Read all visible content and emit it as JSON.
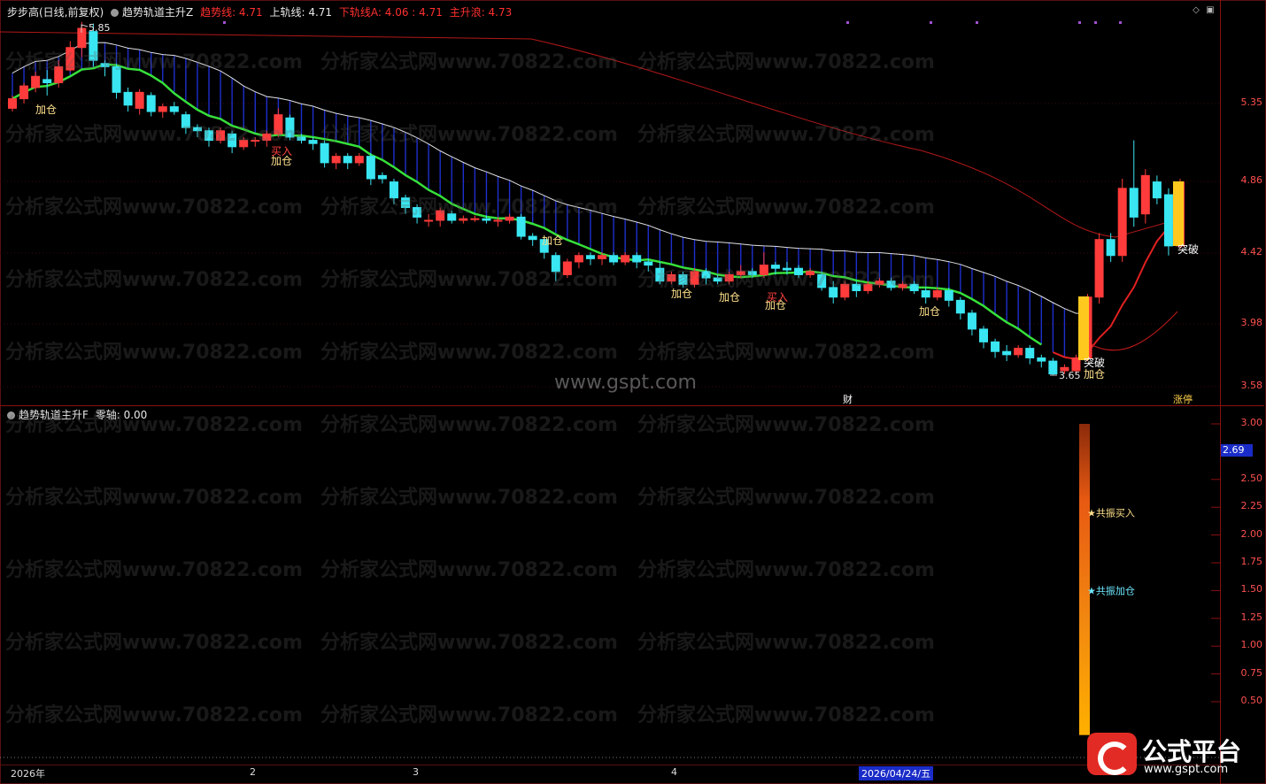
{
  "header": {
    "stock": "步步高(日线,前复权)",
    "indicator": "趋势轨道主升Z",
    "trend_line": "趋势线: 4.71",
    "upper_line": "上轨线: 4.71",
    "lower_line": "下轨线A: 4.06 : 4.71",
    "main_rise": "主升浪: 4.73"
  },
  "sub_header": {
    "indicator": "趋势轨道主升F",
    "zero_axis": "零轴: 0.00"
  },
  "colors": {
    "up": "#ff3b3b",
    "down": "#39e6f2",
    "trend": "#36e03a",
    "upper": "#e0e0e0",
    "fill": "#1e2fcc",
    "red_line": "#e02020",
    "gold": "#ffc81e"
  },
  "price_axis": [
    "5.35",
    "4.86",
    "4.42",
    "3.98",
    "3.58"
  ],
  "sub_axis": [
    "3.00",
    "2.50",
    "2.25",
    "2.00",
    "1.75",
    "1.50",
    "1.25",
    "1.00",
    "0.75",
    "0.50"
  ],
  "sub_value_tag": "2.69",
  "high_label": "5.85",
  "low_label": "3.65",
  "watermark_text": "分析家公式网www.70822.com",
  "center_watermark": "www.gspt.com",
  "dates": {
    "d1": "2026年",
    "d2": "2",
    "d3": "3",
    "d4": "4",
    "d5": "2026/04/24/五"
  },
  "markers": {
    "jiacang": "加仓",
    "mairu": "买入",
    "tupo": "突破",
    "cai": "财",
    "zhangting": "涨停",
    "gongzhen_buy": "★共振买入",
    "gongzhen_add": "★共振加仓"
  },
  "logo": {
    "name": "公式平台",
    "url": "www.gspt.com"
  },
  "chart_data": {
    "type": "candlestick",
    "title": "步步高(日线,前复权)",
    "ylim": [
      3.55,
      5.9
    ],
    "candles": [
      [
        5.32,
        5.38,
        5.3,
        5.4
      ],
      [
        5.38,
        5.46,
        5.35,
        5.48
      ],
      [
        5.45,
        5.52,
        5.42,
        5.55
      ],
      [
        5.5,
        5.48,
        5.4,
        5.56
      ],
      [
        5.48,
        5.58,
        5.45,
        5.62
      ],
      [
        5.56,
        5.7,
        5.55,
        5.74
      ],
      [
        5.7,
        5.82,
        5.64,
        5.86
      ],
      [
        5.8,
        5.62,
        5.58,
        5.85
      ],
      [
        5.6,
        5.58,
        5.52,
        5.62
      ],
      [
        5.58,
        5.42,
        5.38,
        5.6
      ],
      [
        5.42,
        5.34,
        5.3,
        5.45
      ],
      [
        5.32,
        5.42,
        5.28,
        5.44
      ],
      [
        5.4,
        5.3,
        5.27,
        5.42
      ],
      [
        5.3,
        5.33,
        5.26,
        5.35
      ],
      [
        5.33,
        5.3,
        5.28,
        5.36
      ],
      [
        5.28,
        5.2,
        5.16,
        5.3
      ],
      [
        5.2,
        5.18,
        5.14,
        5.22
      ],
      [
        5.18,
        5.12,
        5.08,
        5.2
      ],
      [
        5.12,
        5.18,
        5.1,
        5.2
      ],
      [
        5.16,
        5.08,
        5.04,
        5.18
      ],
      [
        5.08,
        5.12,
        5.06,
        5.14
      ],
      [
        5.12,
        5.12,
        5.08,
        5.14
      ],
      [
        5.12,
        5.16,
        5.08,
        5.18
      ],
      [
        5.16,
        5.28,
        5.14,
        5.32
      ],
      [
        5.26,
        5.14,
        5.12,
        5.28
      ],
      [
        5.14,
        5.12,
        5.1,
        5.16
      ],
      [
        5.12,
        5.1,
        5.06,
        5.14
      ],
      [
        5.1,
        4.98,
        4.95,
        5.12
      ],
      [
        4.98,
        5.02,
        4.94,
        5.04
      ],
      [
        5.02,
        4.98,
        4.94,
        5.04
      ],
      [
        4.98,
        5.02,
        4.96,
        5.04
      ],
      [
        5.02,
        4.88,
        4.84,
        5.04
      ],
      [
        4.9,
        4.88,
        4.85,
        4.92
      ],
      [
        4.86,
        4.76,
        4.72,
        4.88
      ],
      [
        4.76,
        4.7,
        4.66,
        4.78
      ],
      [
        4.7,
        4.64,
        4.6,
        4.72
      ],
      [
        4.62,
        4.62,
        4.58,
        4.66
      ],
      [
        4.62,
        4.68,
        4.58,
        4.7
      ],
      [
        4.66,
        4.62,
        4.6,
        4.68
      ],
      [
        4.62,
        4.63,
        4.6,
        4.65
      ],
      [
        4.63,
        4.63,
        4.61,
        4.65
      ],
      [
        4.63,
        4.62,
        4.6,
        4.65
      ],
      [
        4.62,
        4.62,
        4.58,
        4.64
      ],
      [
        4.62,
        4.64,
        4.6,
        4.66
      ],
      [
        4.64,
        4.52,
        4.5,
        4.66
      ],
      [
        4.52,
        4.5,
        4.46,
        4.54
      ],
      [
        4.5,
        4.42,
        4.38,
        4.52
      ],
      [
        4.4,
        4.3,
        4.24,
        4.42
      ],
      [
        4.28,
        4.36,
        4.26,
        4.38
      ],
      [
        4.36,
        4.4,
        4.32,
        4.42
      ],
      [
        4.4,
        4.38,
        4.34,
        4.42
      ],
      [
        4.38,
        4.4,
        4.34,
        4.42
      ],
      [
        4.4,
        4.36,
        4.34,
        4.42
      ],
      [
        4.36,
        4.4,
        4.34,
        4.42
      ],
      [
        4.4,
        4.36,
        4.32,
        4.42
      ],
      [
        4.36,
        4.34,
        4.3,
        4.38
      ],
      [
        4.32,
        4.24,
        4.22,
        4.36
      ],
      [
        4.24,
        4.28,
        4.22,
        4.3
      ],
      [
        4.28,
        4.22,
        4.2,
        4.3
      ],
      [
        4.22,
        4.3,
        4.2,
        4.32
      ],
      [
        4.3,
        4.26,
        4.22,
        4.32
      ],
      [
        4.26,
        4.24,
        4.22,
        4.28
      ],
      [
        4.24,
        4.28,
        4.22,
        4.3
      ],
      [
        4.28,
        4.3,
        4.26,
        4.34
      ],
      [
        4.3,
        4.28,
        4.26,
        4.32
      ],
      [
        4.28,
        4.34,
        4.26,
        4.42
      ],
      [
        4.34,
        4.32,
        4.28,
        4.36
      ],
      [
        4.32,
        4.31,
        4.28,
        4.36
      ],
      [
        4.32,
        4.28,
        4.26,
        4.34
      ],
      [
        4.28,
        4.3,
        4.26,
        4.32
      ],
      [
        4.28,
        4.2,
        4.18,
        4.3
      ],
      [
        4.2,
        4.14,
        4.1,
        4.24
      ],
      [
        4.14,
        4.22,
        4.12,
        4.24
      ],
      [
        4.22,
        4.18,
        4.14,
        4.24
      ],
      [
        4.18,
        4.22,
        4.16,
        4.24
      ],
      [
        4.22,
        4.24,
        4.2,
        4.26
      ],
      [
        4.24,
        4.2,
        4.18,
        4.26
      ],
      [
        4.2,
        4.22,
        4.18,
        4.24
      ],
      [
        4.22,
        4.18,
        4.16,
        4.24
      ],
      [
        4.18,
        4.14,
        4.1,
        4.2
      ],
      [
        4.14,
        4.18,
        4.12,
        4.2
      ],
      [
        4.18,
        4.12,
        4.08,
        4.2
      ],
      [
        4.12,
        4.04,
        4.0,
        4.14
      ],
      [
        4.04,
        3.94,
        3.9,
        4.06
      ],
      [
        3.94,
        3.86,
        3.82,
        3.96
      ],
      [
        3.86,
        3.8,
        3.76,
        3.88
      ],
      [
        3.8,
        3.78,
        3.74,
        3.84
      ],
      [
        3.78,
        3.82,
        3.76,
        3.84
      ],
      [
        3.82,
        3.76,
        3.72,
        3.84
      ],
      [
        3.76,
        3.74,
        3.7,
        3.78
      ],
      [
        3.74,
        3.66,
        3.65,
        3.76
      ],
      [
        3.68,
        3.7,
        3.66,
        3.72
      ],
      [
        3.68,
        3.76,
        3.66,
        3.78
      ],
      [
        3.76,
        4.14,
        3.74,
        4.16
      ],
      [
        4.14,
        4.5,
        4.1,
        4.54
      ],
      [
        4.5,
        4.4,
        4.36,
        4.54
      ],
      [
        4.4,
        4.82,
        4.36,
        4.88
      ],
      [
        4.82,
        4.64,
        4.58,
        5.12
      ],
      [
        4.66,
        4.9,
        4.6,
        4.94
      ],
      [
        4.86,
        4.76,
        4.72,
        4.9
      ],
      [
        4.78,
        4.46,
        4.4,
        4.82
      ],
      [
        4.46,
        4.86,
        4.44,
        4.88
      ]
    ]
  }
}
